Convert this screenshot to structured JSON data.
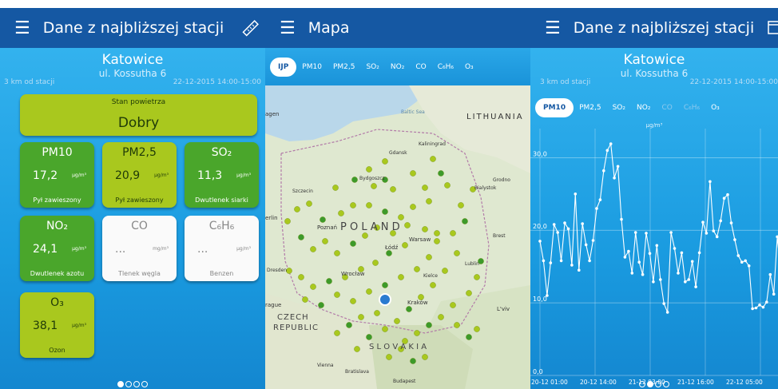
{
  "screen1": {
    "title": "Dane z najbliższej stacji",
    "city": "Katowice",
    "street": "ul. Kossutha 6",
    "distance": "3 km od stacji",
    "datetime": "22-12-2015 14:00-15:00",
    "status_label": "Stan powietrza",
    "status_value": "Dobry",
    "tiles": [
      {
        "name": "PM10",
        "value": "17,2",
        "unit": "μg/m³",
        "desc": "Pył zawieszony"
      },
      {
        "name": "PM2,5",
        "value": "20,9",
        "unit": "μg/m³",
        "desc": "Pył zawieszony"
      },
      {
        "name": "SO₂",
        "value": "11,3",
        "unit": "μg/m³",
        "desc": "Dwutlenek siarki"
      },
      {
        "name": "NO₂",
        "value": "24,1",
        "unit": "μg/m³",
        "desc": "Dwutlenek azotu"
      },
      {
        "name": "CO",
        "value": "...",
        "unit": "mg/m³",
        "desc": "Tlenek węgla"
      },
      {
        "name": "C₆H₆",
        "value": "...",
        "unit": "μg/m³",
        "desc": "Benzen"
      },
      {
        "name": "O₃",
        "value": "38,1",
        "unit": "μg/m³",
        "desc": "Ozon"
      }
    ]
  },
  "screen2": {
    "title": "Mapa",
    "tabs": [
      "IJP",
      "PM10",
      "PM2,5",
      "SO₂",
      "NO₂",
      "CO",
      "C₆H₆",
      "O₃"
    ],
    "map_labels": {
      "baltic": "Baltic Sea",
      "lithuania": "LITHUANIA",
      "kaliningrad": "Kaliningrad",
      "gdansk": "Gdansk",
      "grodno": "Grodno",
      "szczecin": "Szczecin",
      "bydgoszcz": "Bydgoszcz",
      "bialystok": "Bialystok",
      "poznan": "Poznań",
      "poland": "P O L A N D",
      "warsaw": "Warsaw",
      "lodz": "Łódź",
      "brest": "Brest",
      "dresden": "Dresden",
      "wroclaw": "Wrocław",
      "kielce": "Kielce",
      "lublin": "Lublin",
      "krakow": "Kraków",
      "lviv": "L'viv",
      "czech": "CZECH",
      "republic": "REPUBLIC",
      "slovakia": "S L O V A K I A",
      "vienna": "Vienna",
      "bratislava": "Bratislava",
      "budapest": "Budapest",
      "ragu": "rague",
      "erlin": "erlin",
      "agen": "agen"
    },
    "stations": [
      [
        150,
        95
      ],
      [
        130,
        105
      ],
      [
        112,
        118
      ],
      [
        88,
        128
      ],
      [
        136,
        126
      ],
      [
        150,
        118
      ],
      [
        160,
        130
      ],
      [
        185,
        110
      ],
      [
        200,
        128
      ],
      [
        220,
        110
      ],
      [
        228,
        125
      ],
      [
        205,
        145
      ],
      [
        185,
        152
      ],
      [
        170,
        165
      ],
      [
        150,
        158
      ],
      [
        130,
        150
      ],
      [
        110,
        150
      ],
      [
        95,
        160
      ],
      [
        72,
        168
      ],
      [
        55,
        148
      ],
      [
        40,
        155
      ],
      [
        28,
        170
      ],
      [
        45,
        190
      ],
      [
        60,
        205
      ],
      [
        75,
        195
      ],
      [
        90,
        210
      ],
      [
        110,
        198
      ],
      [
        125,
        188
      ],
      [
        140,
        178
      ],
      [
        160,
        185
      ],
      [
        175,
        200
      ],
      [
        155,
        210
      ],
      [
        138,
        222
      ],
      [
        120,
        230
      ],
      [
        100,
        240
      ],
      [
        80,
        245
      ],
      [
        60,
        252
      ],
      [
        45,
        240
      ],
      [
        30,
        232
      ],
      [
        50,
        268
      ],
      [
        70,
        275
      ],
      [
        90,
        262
      ],
      [
        110,
        270
      ],
      [
        130,
        258
      ],
      [
        150,
        250
      ],
      [
        170,
        240
      ],
      [
        190,
        230
      ],
      [
        205,
        215
      ],
      [
        215,
        195
      ],
      [
        235,
        185
      ],
      [
        250,
        170
      ],
      [
        240,
        210
      ],
      [
        225,
        232
      ],
      [
        210,
        250
      ],
      [
        195,
        265
      ],
      [
        180,
        280
      ],
      [
        165,
        295
      ],
      [
        150,
        305
      ],
      [
        140,
        285
      ],
      [
        120,
        290
      ],
      [
        105,
        300
      ],
      [
        90,
        310
      ],
      [
        175,
        320
      ],
      [
        190,
        310
      ],
      [
        205,
        300
      ],
      [
        220,
        290
      ],
      [
        235,
        275
      ],
      [
        255,
        260
      ],
      [
        265,
        240
      ],
      [
        270,
        220
      ],
      [
        245,
        150
      ],
      [
        260,
        130
      ],
      [
        200,
        340
      ],
      [
        185,
        345
      ],
      [
        170,
        330
      ],
      [
        155,
        340
      ],
      [
        240,
        300
      ],
      [
        255,
        315
      ],
      [
        265,
        305
      ],
      [
        115,
        330
      ],
      [
        130,
        315
      ],
      [
        215,
        185
      ],
      [
        200,
        180
      ],
      [
        178,
        175
      ],
      [
        210,
        92
      ]
    ],
    "dark_indices": [
      2,
      5,
      9,
      14,
      18,
      22,
      26,
      31,
      35,
      40,
      44,
      50,
      55,
      60,
      64,
      69,
      73,
      77,
      80
    ],
    "cluster_note": ""
  },
  "screen3": {
    "title": "Dane z najbliższej stacji",
    "city": "Katowice",
    "street": "ul. Kossutha 6",
    "distance": "3 km od stacji",
    "datetime": "22-12-2015 14:00-15:00",
    "tabs": [
      "PM10",
      "PM2,5",
      "SO₂",
      "NO₂",
      "CO",
      "C₆H₆",
      "O₃"
    ],
    "unit": "μg/m³"
  },
  "chart_data": {
    "type": "line",
    "ylabel": "μg/m³",
    "ylim": [
      0,
      34
    ],
    "yticks": [
      "30,0",
      "20,0",
      "10,0",
      "0,0"
    ],
    "ytick_values": [
      30,
      20,
      10,
      0
    ],
    "xticks": [
      "20-12 01:00",
      "20-12 14:00",
      "21-12 03:00",
      "21-12 16:00",
      "22-12 05:00"
    ],
    "series": [
      {
        "values": [
          18.5,
          15.8,
          11,
          15.5,
          20.8,
          19.7,
          15.8,
          21,
          20.2,
          15.2,
          25,
          14.5,
          20.9,
          18,
          15.8,
          18.6,
          23,
          24.2,
          28.2,
          31,
          31.9,
          27.2,
          28.8,
          21.5,
          16.3,
          17.1,
          14.1,
          19.7,
          15.6,
          13.9,
          19.6,
          16.8,
          12.9,
          17.9,
          13.2,
          9.9,
          8.7,
          19.7,
          17.5,
          14.1,
          16.9,
          12.9,
          13.2,
          15.7,
          12.2,
          16.9,
          21.1,
          19.6,
          26.7,
          19.9,
          19.1,
          21.3,
          24.4,
          24.9,
          21,
          18.7,
          16.5,
          15.6,
          15.8,
          15.1,
          9.2,
          9.3,
          9.7,
          9.4,
          10.1,
          13.9,
          11.2,
          19.1,
          14,
          17.8
        ]
      }
    ]
  }
}
